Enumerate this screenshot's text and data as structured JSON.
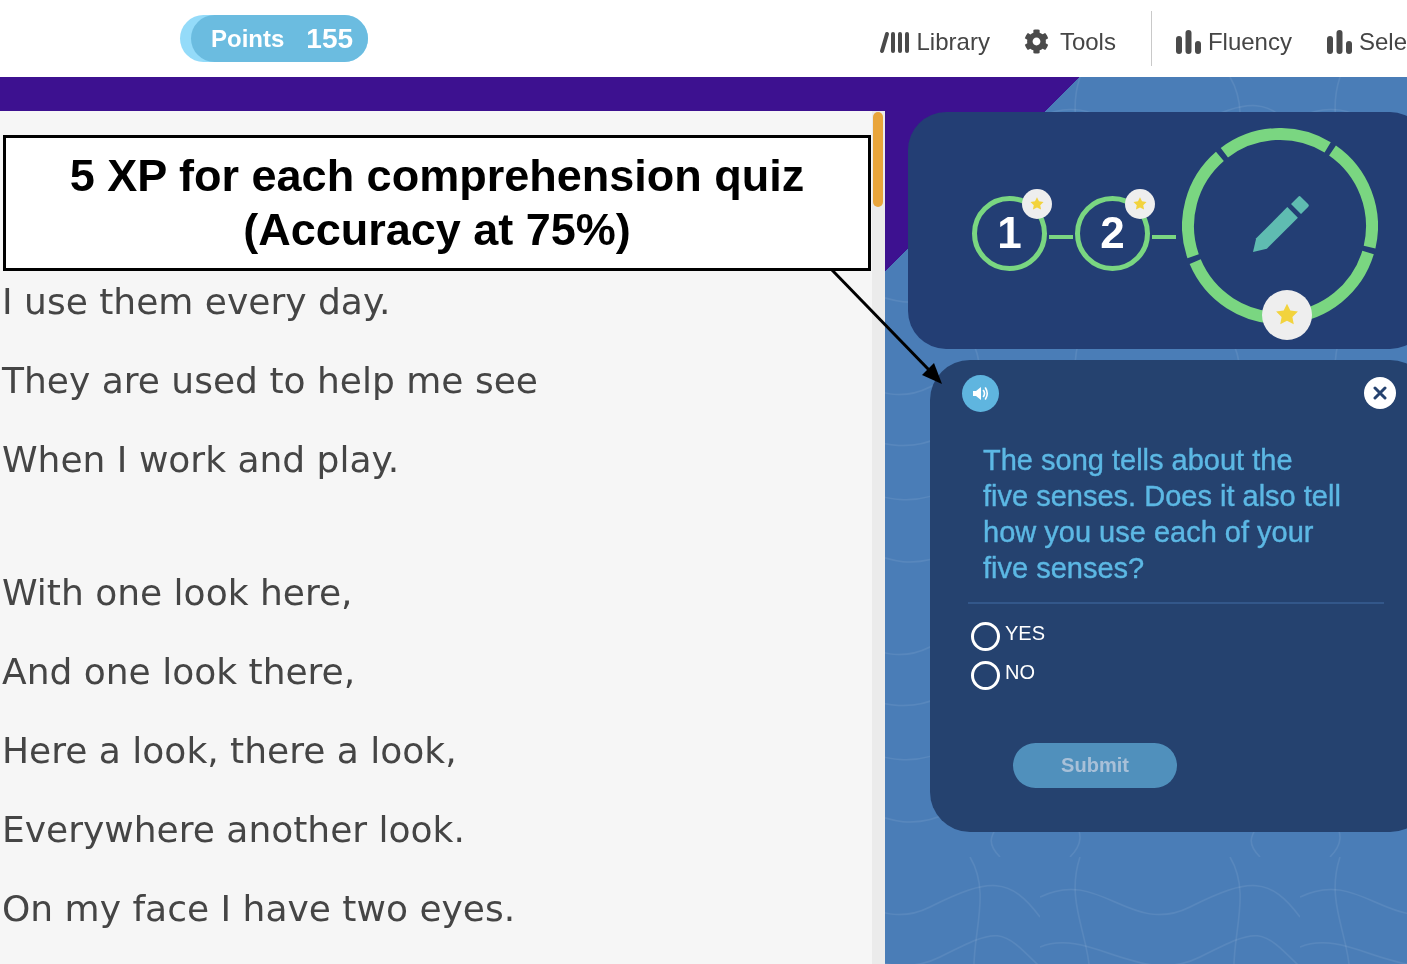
{
  "header": {
    "points": {
      "label": "Points",
      "value": "155"
    },
    "nav_groups": [
      [
        {
          "kind": "library",
          "label": "Library"
        },
        {
          "kind": "tools",
          "label": "Tools"
        }
      ],
      [
        {
          "kind": "stats",
          "label": "Fluency"
        },
        {
          "kind": "stats",
          "label": "Sele"
        }
      ]
    ]
  },
  "annotation": {
    "text": "5 XP for each comprehension quiz (Accuracy at 75%)"
  },
  "passage": {
    "stanzas": [
      [
        "I use them every day.",
        "They are used to help me see",
        "When I work and play."
      ],
      [
        "With one look here,",
        "And one look there,",
        "Here a look, there a look,",
        "Everywhere another look.",
        "On my face I have two eyes."
      ]
    ]
  },
  "progress": {
    "steps": [
      {
        "label": "1",
        "starred": true
      },
      {
        "label": "2",
        "starred": true
      }
    ],
    "quiz_step": {
      "starred": true
    }
  },
  "quiz": {
    "question": "The song tells about the five senses. Does it also tell how you use each of your five senses?",
    "options": [
      {
        "label": "YES",
        "selected": false
      },
      {
        "label": "NO",
        "selected": false
      }
    ],
    "submit": {
      "label": "Submit",
      "disabled": true
    }
  }
}
